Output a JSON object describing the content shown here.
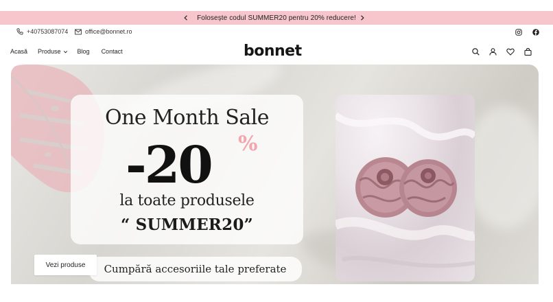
{
  "announcement": {
    "text": "Folosește codul SUMMER20 pentru 20% reducere!",
    "prev_icon": "chevron-left-icon",
    "next_icon": "chevron-right-icon",
    "bg_color": "#f7c6cc"
  },
  "contact": {
    "phone": "+40753087074",
    "email": "office@bonnet.ro"
  },
  "social": [
    "instagram-icon",
    "facebook-icon"
  ],
  "nav": {
    "links": [
      "Acasă",
      "Produse",
      "Blog",
      "Contact"
    ],
    "logo": "bonnet",
    "icons": [
      "search-icon",
      "account-icon",
      "heart-icon",
      "bag-icon"
    ]
  },
  "hero": {
    "title": "One Month Sale",
    "discount": "-20",
    "percent": "%",
    "line": "la toate produsele",
    "code": "“ SUMMER20”",
    "tagline": "Cumpără accesoriile tale preferate",
    "button": "Vezi produse",
    "accent_color": "#f4a5ad"
  }
}
